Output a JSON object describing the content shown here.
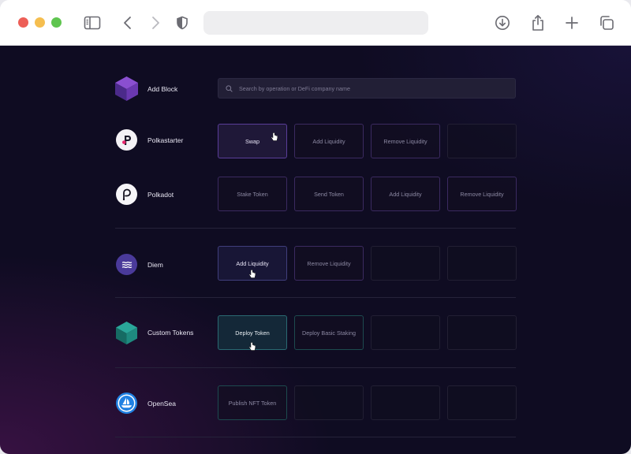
{
  "browser": {
    "icons": [
      "sidebar-icon",
      "back-icon",
      "forward-icon",
      "shield-icon",
      "download-icon",
      "share-icon",
      "new-tab-icon",
      "tabs-icon"
    ]
  },
  "add_block": {
    "label": "Add Block",
    "search_placeholder": "Search by operation or DeFi company name"
  },
  "rows": {
    "polkastarter": {
      "label": "Polkastarter",
      "ops": [
        "Swap",
        "Add Liquidity",
        "Remove Liquidity"
      ]
    },
    "polkadot": {
      "label": "Polkadot",
      "ops": [
        "Stake Token",
        "Send Token",
        "Add Liquidity",
        "Remove Liquidity"
      ]
    },
    "diem": {
      "label": "Diem",
      "ops": [
        "Add Liquidity",
        "Remove Liquidity"
      ]
    },
    "custom_tokens": {
      "label": "Custom Tokens",
      "ops": [
        "Deploy Token",
        "Deploy Basic Staking"
      ]
    },
    "opensea": {
      "label": "OpenSea",
      "ops": [
        "Publish NFT Token"
      ]
    }
  },
  "colors": {
    "background": "#0f0c22",
    "accent_purple": "#5a3d99",
    "accent_teal": "#2a6a72",
    "polkastarter_pink": "#e8246b",
    "diem_purple": "#4a3a9a",
    "opensea_blue": "#2081e2"
  }
}
